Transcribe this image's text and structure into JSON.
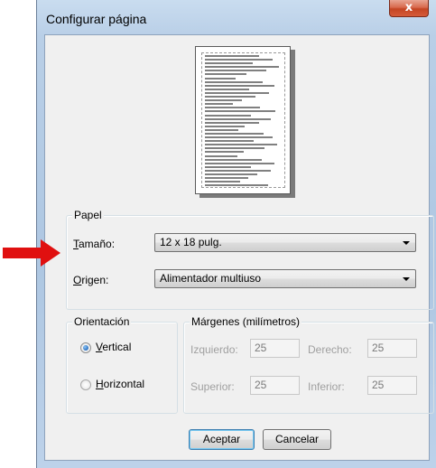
{
  "window": {
    "title": "Configurar página",
    "close_glyph": "x"
  },
  "preview": {
    "line_count": 36
  },
  "paper": {
    "group_label": "Papel",
    "size_label": "Tamaño:",
    "size_value": "12 x 18 pulg.",
    "source_label": "Origen:",
    "source_value": "Alimentador multiuso"
  },
  "orientation": {
    "group_label": "Orientación",
    "portrait_label": "Vertical",
    "landscape_label": "Horizontal",
    "selected": "portrait"
  },
  "margins": {
    "group_label": "Márgenes (milímetros)",
    "left_label": "Izquierdo:",
    "left_value": "25",
    "right_label": "Derecho:",
    "right_value": "25",
    "top_label": "Superior:",
    "top_value": "25",
    "bottom_label": "Inferior:",
    "bottom_value": "25"
  },
  "buttons": {
    "ok": "Aceptar",
    "cancel": "Cancelar"
  },
  "annotation": {
    "arrow_color": "#e01010",
    "arrow_icon": "red-arrow-icon"
  }
}
